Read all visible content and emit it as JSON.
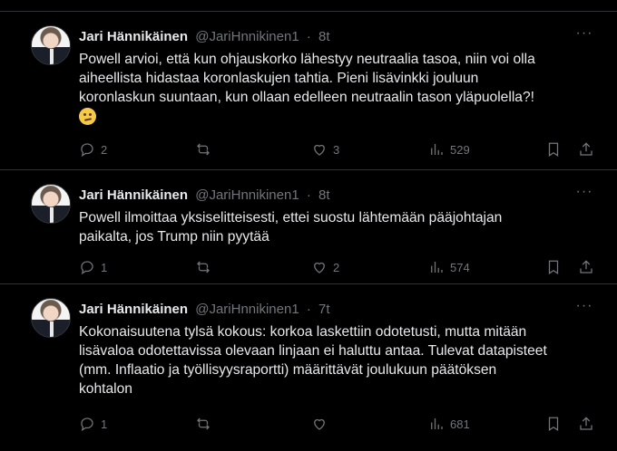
{
  "top_stub": {
    "icon": "share-icon"
  },
  "tweets": [
    {
      "author": {
        "name": "Jari Hännikäinen",
        "handle": "@JariHnnikinen1",
        "time": "8t"
      },
      "text_parts": [
        "Powell arvioi, että kun ohjauskorko lähestyy neutraalia tasoa, niin voi olla",
        "aiheellista hidastaa koronlaskujen tahtia. Pieni lisävinkki jouluun",
        "koronlaskun suuntaan, kun ollaan edelleen neutraalin tason yläpuolella?!"
      ],
      "emoji": "thinking-face",
      "metrics": {
        "replies": "2",
        "retweets": "",
        "likes": "3",
        "views": "529"
      }
    },
    {
      "author": {
        "name": "Jari Hännikäinen",
        "handle": "@JariHnnikinen1",
        "time": "8t"
      },
      "text_parts": [
        "Powell ilmoittaa yksiselitteisesti, ettei suostu lähtemään pääjohtajan",
        "paikalta, jos Trump niin pyytää"
      ],
      "metrics": {
        "replies": "1",
        "retweets": "",
        "likes": "2",
        "views": "574"
      }
    },
    {
      "author": {
        "name": "Jari Hännikäinen",
        "handle": "@JariHnnikinen1",
        "time": "7t"
      },
      "text_parts": [
        "Kokonaisuutena tylsä kokous: korkoa laskettiin odotetusti, mutta mitään",
        "lisävaloa odotettavissa olevaan linjaan ei haluttu antaa. Tulevat datapisteet",
        "(mm. Inflaatio ja työllisyysraportti) määrittävät joulukuun päätöksen",
        "kohtalon"
      ],
      "metrics": {
        "replies": "1",
        "retweets": "",
        "likes": "",
        "views": "681"
      }
    }
  ],
  "ui": {
    "separator": "·",
    "more_label": "···"
  },
  "colors": {
    "background": "#000000",
    "text": "#e7e9ea",
    "muted": "#71767b",
    "border": "#2f3336"
  }
}
